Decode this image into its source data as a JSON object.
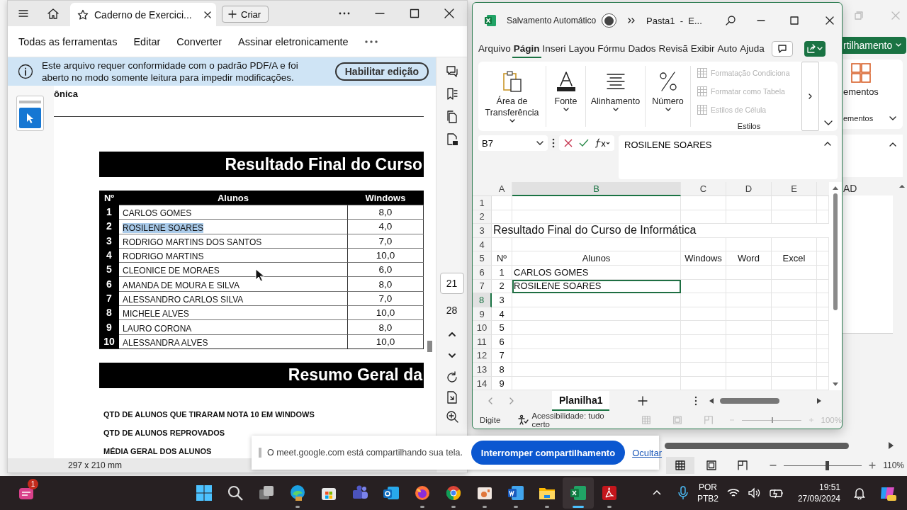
{
  "background_window": {
    "share_button": "rtilhamento",
    "ribbon_label": "ementos",
    "group_label": "ementos",
    "column_header": "AD",
    "views": [
      {
        "kind": "normal",
        "selected": true
      },
      {
        "kind": "layout",
        "selected": false
      },
      {
        "kind": "break",
        "selected": false
      }
    ],
    "zoom": {
      "level": 0.55,
      "reading": "110%"
    }
  },
  "pdf_window": {
    "tab_title": "Caderno de Exercici...",
    "new_button": "Criar",
    "tools": [
      "Todas as ferramentas",
      "Editar",
      "Converter",
      "Assinar eletronicamente"
    ],
    "notice": {
      "text": "Este arquivo requer conformidade com o padrão PDF/A e foi aberto no modo somente leitura para impedir modificações.",
      "button": "Habilitar edição"
    },
    "page": {
      "header_fragment": "ônica",
      "title": "Resultado Final do Curso",
      "columns": [
        "Nº",
        "Alunos",
        "Windows"
      ],
      "rows": [
        {
          "number": "1",
          "name": "CARLOS GOMES",
          "windows": "8,0",
          "selected": false
        },
        {
          "number": "2",
          "name": "ROSILENE SOARES",
          "windows": "4,0",
          "selected": true
        },
        {
          "number": "3",
          "name": "RODRIGO MARTINS DOS SANTOS",
          "windows": "7,0",
          "selected": false
        },
        {
          "number": "4",
          "name": "RODRIGO MARTINS",
          "windows": "10,0",
          "selected": false
        },
        {
          "number": "5",
          "name": "CLEONICE DE MORAES",
          "windows": "6,0",
          "selected": false
        },
        {
          "number": "6",
          "name": "AMANDA DE MOURA E SILVA",
          "windows": "8,0",
          "selected": false
        },
        {
          "number": "7",
          "name": "ALESSANDRO CARLOS SILVA",
          "windows": "7,0",
          "selected": false
        },
        {
          "number": "8",
          "name": "MICHELE ALVES",
          "windows": "10,0",
          "selected": false
        },
        {
          "number": "9",
          "name": "LAURO CORONA",
          "windows": "8,0",
          "selected": false
        },
        {
          "number": "10",
          "name": "ALESSANDRA ALVES",
          "windows": "10,0",
          "selected": false
        }
      ],
      "summary_title": "Resumo Geral da",
      "summary_items": [
        "QTD DE ALUNOS QUE TIRARAM NOTA 10 EM WINDOWS",
        "QTD DE ALUNOS REPROVADOS",
        "MÉDIA GERAL DOS ALUNOS"
      ]
    },
    "page_numbers": [
      {
        "label": "21",
        "selected": true
      },
      {
        "label": "28",
        "selected": false
      }
    ],
    "page_size": "297 x 210 mm"
  },
  "excel_window": {
    "autosave_label": "Salvamento Automático",
    "autosave_on": false,
    "title": "Pasta1  -  E...",
    "tabs": [
      {
        "label": "Arquivo",
        "selected": false
      },
      {
        "label": "Págin",
        "selected": true
      },
      {
        "label": "Inseri",
        "selected": false
      },
      {
        "label": "Layou",
        "selected": false
      },
      {
        "label": "Fórmu",
        "selected": false
      },
      {
        "label": "Dados",
        "selected": false
      },
      {
        "label": "Revisã",
        "selected": false
      },
      {
        "label": "Exibir",
        "selected": false
      },
      {
        "label": "Auto",
        "selected": false
      },
      {
        "label": "Ajuda",
        "selected": false
      }
    ],
    "ribbon_groups": [
      {
        "kind": "clipboard",
        "label": "Área de Transferência"
      },
      {
        "kind": "font",
        "label": "Fonte"
      },
      {
        "kind": "align",
        "label": "Alinhamento"
      },
      {
        "kind": "number",
        "label": "Número"
      }
    ],
    "styles": {
      "label": "Estilos",
      "items": [
        {
          "label": "Formatação Condiciona",
          "disabled": true
        },
        {
          "label": "Formatar como Tabela",
          "disabled": true
        },
        {
          "label": "Estilos de Célula",
          "disabled": true
        }
      ]
    },
    "name_box": "B7",
    "formula": "ROSILENE SOARES",
    "columns": [
      {
        "label": "A",
        "selected": false
      },
      {
        "label": "B",
        "selected": true
      },
      {
        "label": "C",
        "selected": false
      },
      {
        "label": "D",
        "selected": false
      },
      {
        "label": "E",
        "selected": false
      }
    ],
    "rows": [
      {
        "header": "1",
        "selected": false
      },
      {
        "header": "2",
        "selected": false
      },
      {
        "header": "3",
        "selected": false,
        "title": "Resultado Final do Curso de Informática"
      },
      {
        "header": "4",
        "selected": false
      },
      {
        "header": "5",
        "selected": false,
        "cells": {
          "A": "Nº",
          "B": "Alunos",
          "C": "Windows",
          "D": "Word",
          "E": "Excel"
        }
      },
      {
        "header": "6",
        "selected": false,
        "cells": {
          "A": "1",
          "B": "CARLOS GOMES"
        }
      },
      {
        "header": "7",
        "selected": false,
        "cells": {
          "A": "2",
          "B": "ROSILENE SOARES"
        },
        "editing": true
      },
      {
        "header": "8",
        "selected": true,
        "cells": {
          "A": "3"
        }
      },
      {
        "header": "9",
        "selected": false,
        "cells": {
          "A": "4"
        }
      },
      {
        "header": "10",
        "selected": false,
        "cells": {
          "A": "5"
        }
      },
      {
        "header": "11",
        "selected": false,
        "cells": {
          "A": "6"
        }
      },
      {
        "header": "12",
        "selected": false,
        "cells": {
          "A": "7"
        }
      },
      {
        "header": "13",
        "selected": false,
        "cells": {
          "A": "8"
        }
      },
      {
        "header": "14",
        "selected": false,
        "cells": {
          "A": "9"
        }
      }
    ],
    "sheet_tab": {
      "label": "Planilha1",
      "selected": true
    },
    "status": "Digite",
    "accessibility": "Acessibilidade: tudo certo",
    "zoom": {
      "level": 0.5,
      "reading": "100%"
    }
  },
  "share_notice": {
    "message": "O meet.google.com está compartilhando sua tela.",
    "button": "Interromper compartilhamento",
    "link": "Ocultar"
  },
  "taskbar": {
    "widget_badge": "1",
    "apps": [
      {
        "kind": "start",
        "open": false,
        "active": false
      },
      {
        "kind": "search",
        "open": false,
        "active": false
      },
      {
        "kind": "taskview",
        "open": false,
        "active": false
      },
      {
        "kind": "edge",
        "open": true,
        "active": false
      },
      {
        "kind": "store",
        "open": false,
        "active": false
      },
      {
        "kind": "teams",
        "open": false,
        "active": false
      },
      {
        "kind": "outlook",
        "open": false,
        "active": false
      },
      {
        "kind": "firefox",
        "open": true,
        "active": false
      },
      {
        "kind": "chrome",
        "open": true,
        "active": false
      },
      {
        "kind": "photos",
        "open": true,
        "active": false
      },
      {
        "kind": "word",
        "open": true,
        "active": false
      },
      {
        "kind": "explorer",
        "open": true,
        "active": false
      },
      {
        "kind": "excel",
        "open": true,
        "active": true
      },
      {
        "kind": "acrobat",
        "open": true,
        "active": false
      }
    ],
    "language": "POR",
    "layout": "PTB2",
    "time": "19:51",
    "date": "27/09/2024"
  }
}
